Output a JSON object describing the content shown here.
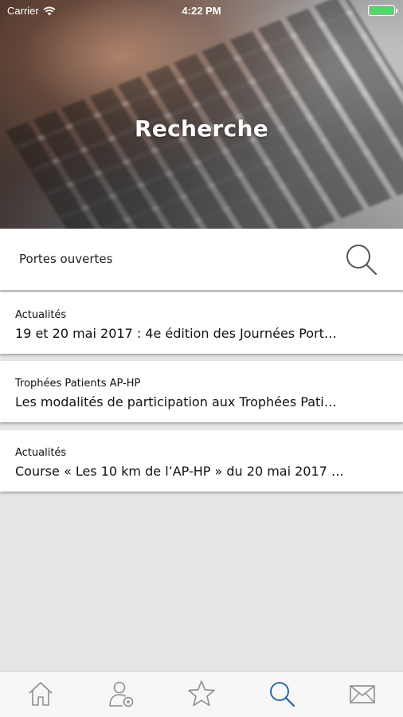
{
  "status_bar": {
    "carrier": "Carrier",
    "time": "4:22 PM",
    "battery_level": 1.0,
    "battery_color": "#4cd964"
  },
  "header": {
    "title": "Recherche",
    "background_icon": "keyboard-photo"
  },
  "search": {
    "value": "Portes ouvertes",
    "icon": "search-icon"
  },
  "results": [
    {
      "category": "Actualités",
      "title": "19 et 20 mai 2017 : 4e édition des Journées Port…"
    },
    {
      "category": "Trophées Patients AP-HP",
      "title": "Les modalités de participation aux Trophées Pati…"
    },
    {
      "category": "Actualités",
      "title": "Course « Les 10 km de l’AP-HP » du 20 mai 2017 …"
    }
  ],
  "tab_bar": {
    "items": [
      {
        "icon": "home-icon",
        "active": false
      },
      {
        "icon": "user-settings-icon",
        "active": false
      },
      {
        "icon": "star-icon",
        "active": false
      },
      {
        "icon": "search-icon",
        "active": true
      },
      {
        "icon": "mail-icon",
        "active": false
      }
    ],
    "active_color": "#1c5d98",
    "inactive_color": "#8e8e93"
  }
}
